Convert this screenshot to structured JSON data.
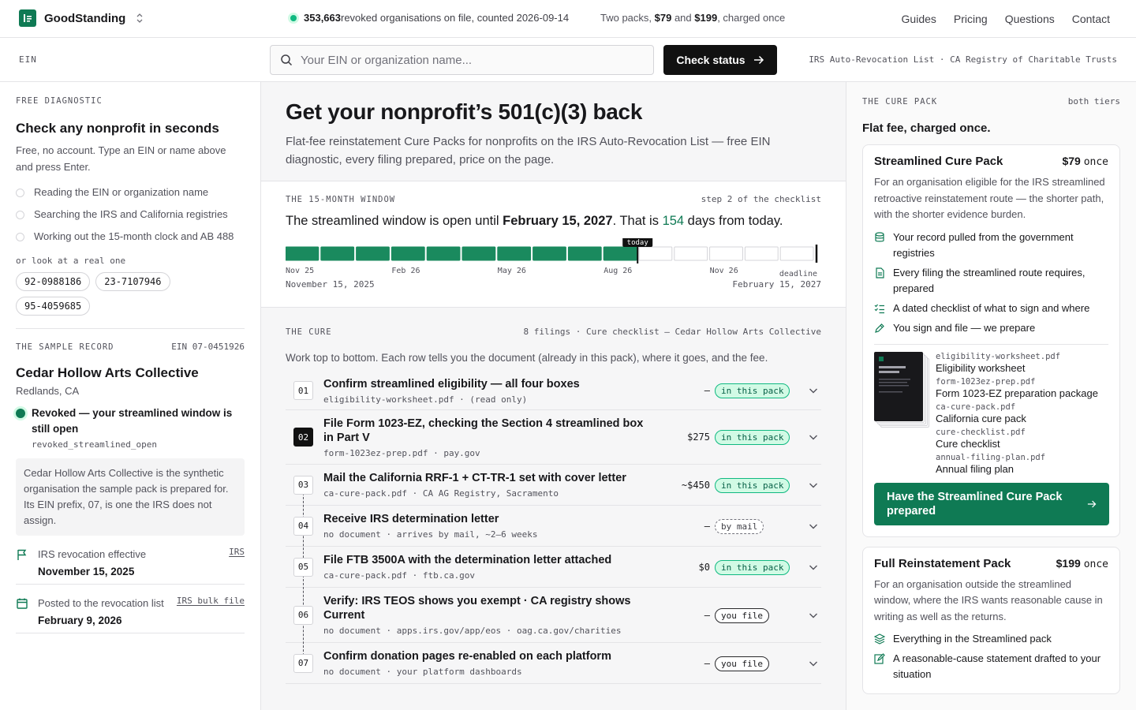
{
  "brand": {
    "name": "GoodStanding"
  },
  "topbar": {
    "stat_count": "353,663",
    "stat_rest": " revoked organisations on file, counted 2026-09-14",
    "packs_a": "Two packs, ",
    "price_a": "$79",
    "packs_b": " and ",
    "price_b": "$199",
    "packs_c": ", charged once",
    "nav": [
      "Guides",
      "Pricing",
      "Questions",
      "Contact"
    ]
  },
  "search": {
    "label": "EIN",
    "placeholder": "Your EIN or organization name...",
    "button": "Check status",
    "sources": "IRS Auto-Revocation List · CA Registry of Charitable Trusts"
  },
  "diagnostic": {
    "eyebrow": "FREE DIAGNOSTIC",
    "title": "Check any nonprofit in seconds",
    "desc": "Free, no account. Type an EIN or name above and press Enter.",
    "steps": [
      "Reading the EIN or organization name",
      "Searching the IRS and California registries",
      "Working out the 15-month clock and AB 488"
    ],
    "or_look": "or look at a real one",
    "examples": [
      "92-0988186",
      "23-7107946",
      "95-4059685"
    ]
  },
  "sample": {
    "eyebrow": "THE SAMPLE RECORD",
    "ein": "EIN 07-0451926",
    "name": "Cedar Hollow Arts Collective",
    "location": "Redlands, CA",
    "status": "Revoked — your streamlined window is still open",
    "status_code": "revoked_streamlined_open",
    "note": "Cedar Hollow Arts Collective is the synthetic organisation the sample pack is prepared for. Its EIN prefix, 07, is one the IRS does not assign.",
    "facts": [
      {
        "label": "IRS revocation effective",
        "value": "November 15, 2025",
        "source": "IRS",
        "icon": "flag-icon"
      },
      {
        "label": "Posted to the revocation list",
        "value": "February 9, 2026",
        "source": "IRS bulk file",
        "icon": "calendar-icon"
      }
    ]
  },
  "hero": {
    "title": "Get your nonprofit’s 501(c)(3) back",
    "subtitle": "Flat-fee reinstatement Cure Packs for nonprofits on the IRS Auto-Revocation List — free EIN diagnostic, every filing prepared, price on the page."
  },
  "window": {
    "eyebrow": "THE 15-MONTH WINDOW",
    "meta": "step 2 of the checklist",
    "head_a": "The streamlined window is open until ",
    "head_date": "February 15, 2027",
    "head_b": ". That is ",
    "days": "154",
    "head_c": " days from today.",
    "months_total": 15,
    "months_elapsed": 10,
    "today_fraction": 0.664,
    "today_label": "today",
    "tick_labels": [
      "Nov 25",
      "Feb 26",
      "May 26",
      "Aug 26",
      "Nov 26"
    ],
    "deadline_label": "deadline",
    "start": "November 15, 2025",
    "end": "February 15, 2027",
    "fill_color": "#1a8a5e"
  },
  "cure": {
    "eyebrow": "THE CURE",
    "meta": "8 filings · Cure checklist — Cedar Hollow Arts Collective",
    "intro": "Work top to bottom. Each row tells you the document (already in this pack), where it goes, and the fee.",
    "rows": [
      {
        "num": "01",
        "title": "Confirm streamlined eligibility — all four boxes",
        "bold": "",
        "title_rest": "",
        "sub": "eligibility-worksheet.pdf · (read only)",
        "fee": "—",
        "status": "in this pack",
        "kind": "pack"
      },
      {
        "num": "02",
        "title": "File Form 1023-EZ, checking the ",
        "bold": "Section 4 streamlined",
        "title_rest": " box in Part V",
        "sub": "form-1023ez-prep.pdf · pay.gov",
        "fee": "$275",
        "status": "in this pack",
        "kind": "pack"
      },
      {
        "num": "03",
        "title": "Mail the California RRF-1 + CT-TR-1 set with cover letter",
        "bold": "",
        "title_rest": "",
        "sub": "ca-cure-pack.pdf · CA AG Registry, Sacramento",
        "fee": "~$450",
        "status": "in this pack",
        "kind": "pack"
      },
      {
        "num": "04",
        "title": "Receive IRS determination letter",
        "bold": "",
        "title_rest": "",
        "sub": "no document · arrives by mail, ~2–6 weeks",
        "fee": "—",
        "status": "by mail",
        "kind": "mail"
      },
      {
        "num": "05",
        "title": "File FTB 3500A with the determination letter attached",
        "bold": "",
        "title_rest": "",
        "sub": "ca-cure-pack.pdf · ftb.ca.gov",
        "fee": "$0",
        "status": "in this pack",
        "kind": "pack"
      },
      {
        "num": "06",
        "title": "Verify: IRS TEOS shows you exempt · CA registry shows Current",
        "bold": "",
        "title_rest": "",
        "sub": "no document · apps.irs.gov/app/eos · oag.ca.gov/charities",
        "fee": "—",
        "status": "you file",
        "kind": "you"
      },
      {
        "num": "07",
        "title": "Confirm donation pages re-enabled on each platform",
        "bold": "",
        "title_rest": "",
        "sub": "no document · your platform dashboards",
        "fee": "—",
        "status": "you file",
        "kind": "you"
      }
    ]
  },
  "packs": {
    "eyebrow": "THE CURE PACK",
    "meta": "both tiers",
    "title": "Flat fee, charged once.",
    "streamlined": {
      "name": "Streamlined Cure Pack",
      "price": "$79",
      "once": "once",
      "desc": "For an organisation eligible for the IRS streamlined retroactive reinstatement route — the shorter path, with the shorter evidence burden.",
      "features": [
        {
          "text": "Your record pulled from the government registries",
          "icon": "database-icon"
        },
        {
          "text": "Every filing the streamlined route requires, prepared",
          "icon": "document-icon"
        },
        {
          "text": "A dated checklist of what to sign and where",
          "icon": "checklist-icon"
        },
        {
          "text": "You sign and file — we prepare",
          "icon": "pen-icon"
        }
      ],
      "files": [
        {
          "path": "eligibility-worksheet.pdf",
          "name": "Eligibility worksheet"
        },
        {
          "path": "form-1023ez-prep.pdf",
          "name": "Form 1023-EZ preparation package"
        },
        {
          "path": "ca-cure-pack.pdf",
          "name": "California cure pack"
        },
        {
          "path": "cure-checklist.pdf",
          "name": "Cure checklist"
        },
        {
          "path": "annual-filing-plan.pdf",
          "name": "Annual filing plan"
        }
      ],
      "cta": "Have the Streamlined Cure Pack prepared"
    },
    "full": {
      "name": "Full Reinstatement Pack",
      "price": "$199",
      "once": "once",
      "desc": "For an organisation outside the streamlined window, where the IRS wants reasonable cause in writing as well as the returns.",
      "features": [
        {
          "text": "Everything in the Streamlined pack",
          "icon": "layers-icon"
        },
        {
          "text": "A reasonable-cause statement drafted to your situation",
          "icon": "edit-icon"
        }
      ]
    }
  }
}
